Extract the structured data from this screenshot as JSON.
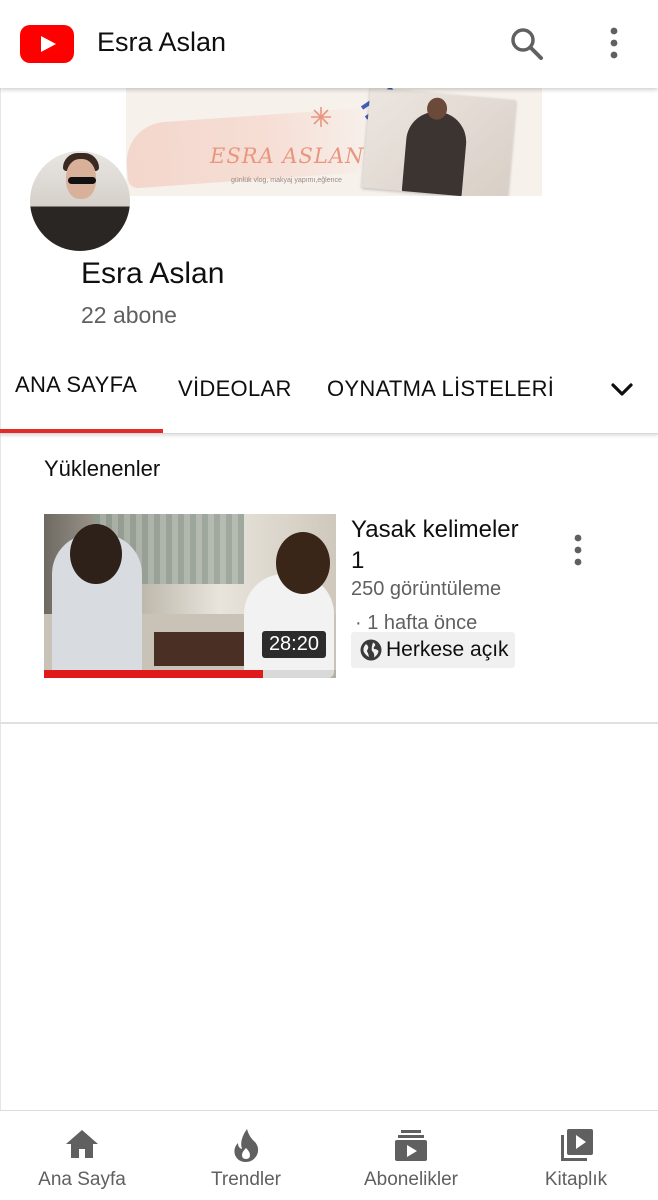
{
  "appbar": {
    "title": "Esra Aslan",
    "logo_icon": "youtube-logo-icon",
    "search_icon": "search-icon",
    "more_icon": "more-vertical-icon",
    "brand_color": "#ff0000"
  },
  "banner": {
    "title": "ESRA ASLAN",
    "subtitle": "günlük vlog, makyaj yapımı,eğlence"
  },
  "channel": {
    "name": "Esra Aslan",
    "subscribers": "22 abone"
  },
  "tabs": {
    "home": "ANA SAYFA",
    "videos": "VİDEOLAR",
    "playlists": "OYNATMA LİSTELERİ",
    "expand_icon": "chevron-down-icon",
    "active": "home",
    "accent_color": "#e12b26"
  },
  "uploads": {
    "section_title": "Yüklenenler",
    "video": {
      "title": "Yasak kelimeler 1",
      "views": "250 görüntüleme",
      "age": "· 1 hafta önce",
      "visibility": "Herkese açık",
      "duration": "28:20",
      "watched_fraction": 0.75,
      "menu_icon": "more-vertical-icon",
      "visibility_icon": "globe-icon"
    }
  },
  "bottom_nav": {
    "home": "Ana Sayfa",
    "trending": "Trendler",
    "subscriptions": "Abonelikler",
    "library": "Kitaplık"
  }
}
